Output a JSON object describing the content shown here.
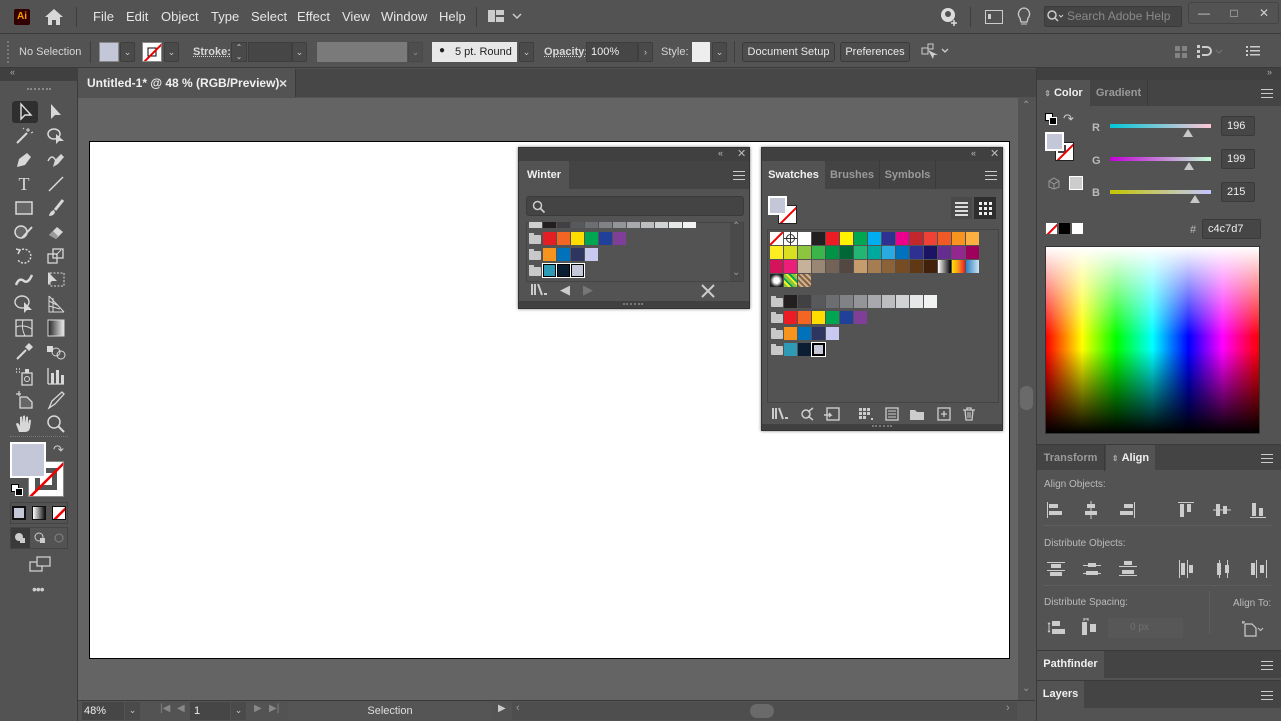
{
  "app": {
    "logo": "Ai",
    "home_icon": "home-icon"
  },
  "menu": [
    "File",
    "Edit",
    "Object",
    "Type",
    "Select",
    "Effect",
    "View",
    "Window",
    "Help"
  ],
  "search": {
    "placeholder": "Search Adobe Help"
  },
  "window_controls": {
    "minimize": "—",
    "maximize": "□",
    "close": "✕"
  },
  "control_bar": {
    "selection_label": "No Selection",
    "stroke_label": "Stroke:",
    "brush_label": "5 pt. Round",
    "opacity_label": "Opacity:",
    "opacity_value": "100%",
    "style_label": "Style:",
    "document_setup": "Document Setup",
    "preferences": "Preferences"
  },
  "document": {
    "tab_title": "Untitled-1* @ 48 % (RGB/Preview)",
    "close": "×"
  },
  "status_bar": {
    "zoom": "48%",
    "artboard": "1",
    "tool": "Selection"
  },
  "winter_panel": {
    "title": "Winter",
    "search_value": "",
    "groups": [
      [
        "#e31e24",
        "#f26522",
        "#ffdd00",
        "#00a651",
        "#21409a",
        "#7f3f98"
      ],
      [
        "#f7941d",
        "#0072bc",
        "#2e3561",
        "#c8c8f0"
      ],
      [
        "#2e9ab5",
        "#0b1d33",
        "#c4c7d7"
      ]
    ],
    "grays": [
      "#cfcfcf",
      "#231f20",
      "#414042",
      "#58595b",
      "#6d6e71",
      "#808285",
      "#939598",
      "#a7a9ac",
      "#bcbec0",
      "#d1d3d4",
      "#e6e7e8",
      "#f1f2f2"
    ]
  },
  "swatches_panel": {
    "tabs": [
      "Swatches",
      "Brushes",
      "Symbols"
    ],
    "active_tab": "Swatches",
    "rows": [
      [
        "none",
        "registration",
        "#ffffff",
        "#231f20",
        "#ed1c24",
        "#fff200",
        "#00a651",
        "#00aeef",
        "#2e3192",
        "#ec008c",
        "#c1272d",
        "#ef4136",
        "#f15a24",
        "#f7931e",
        "#fbb040"
      ],
      [
        "#fcee21",
        "#d9e021",
        "#8cc63f",
        "#39b54a",
        "#009245",
        "#006837",
        "#22b573",
        "#00a99d",
        "#29abe2",
        "#0071bc",
        "#2e3192",
        "#1b1464",
        "#662d91",
        "#93278f",
        "#9e005d"
      ],
      [
        "#d4145a",
        "#ed1e79",
        "#c7b299",
        "#998675",
        "#736357",
        "#534741",
        "#c69c6d",
        "#a67c52",
        "#8c6239",
        "#754c24",
        "#603813",
        "#42210b",
        "gradient-bw",
        "gradient-orange",
        "gradient-blue"
      ],
      [
        "pattern-dots",
        "pattern-green",
        "pattern-brown"
      ]
    ],
    "grays": [
      "#231f20",
      "#414042",
      "#58595b",
      "#6d6e71",
      "#808285",
      "#939598",
      "#a7a9ac",
      "#bcbec0",
      "#d1d3d4",
      "#e6e7e8",
      "#f1f2f2"
    ],
    "groups": [
      [
        "#ed1c24",
        "#f26522",
        "#ffdd00",
        "#00a651",
        "#21409a",
        "#7f3f98"
      ],
      [
        "#f7941d",
        "#0072bc",
        "#2e3561",
        "#c8c8f0"
      ],
      [
        "#2e9ab5",
        "#0b1d33",
        "#c4c7d7"
      ]
    ]
  },
  "color_panel": {
    "tabs": [
      "Color",
      "Gradient"
    ],
    "active_tab": "Color",
    "r_label": "R",
    "g_label": "G",
    "b_label": "B",
    "r": "196",
    "g": "199",
    "b": "215",
    "r_fraction": 0.769,
    "g_fraction": 0.78,
    "b_fraction": 0.843,
    "hex_label": "#",
    "hex": "c4c7d7",
    "fill_color": "#c4c7d7"
  },
  "align_panel": {
    "tabs": [
      "Transform",
      "Align"
    ],
    "active_tab": "Align",
    "align_objects": "Align Objects:",
    "distribute_objects": "Distribute Objects:",
    "distribute_spacing": "Distribute Spacing:",
    "align_to": "Align To:",
    "spacing_value": "0 px"
  },
  "collapsed_panels": [
    "Pathfinder",
    "Layers"
  ]
}
